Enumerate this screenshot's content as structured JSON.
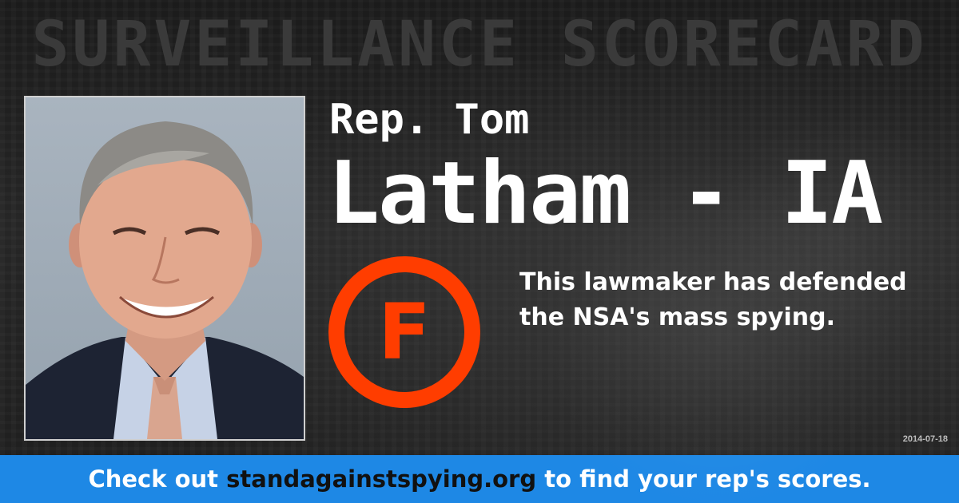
{
  "header": {
    "title": "SURVEILLANCE SCORECARD"
  },
  "representative": {
    "prefix": "Rep. Tom",
    "name_line": "Latham - IA"
  },
  "score": {
    "grade": "F",
    "grade_color": "#ff3d00",
    "description": "This lawmaker has defended the NSA's mass spying."
  },
  "date": "2014-07-18",
  "footer": {
    "text_before": "Check out ",
    "url": "standagainstspying.org",
    "text_after": " to find your rep's scores.",
    "background_color": "#1e88e5"
  }
}
